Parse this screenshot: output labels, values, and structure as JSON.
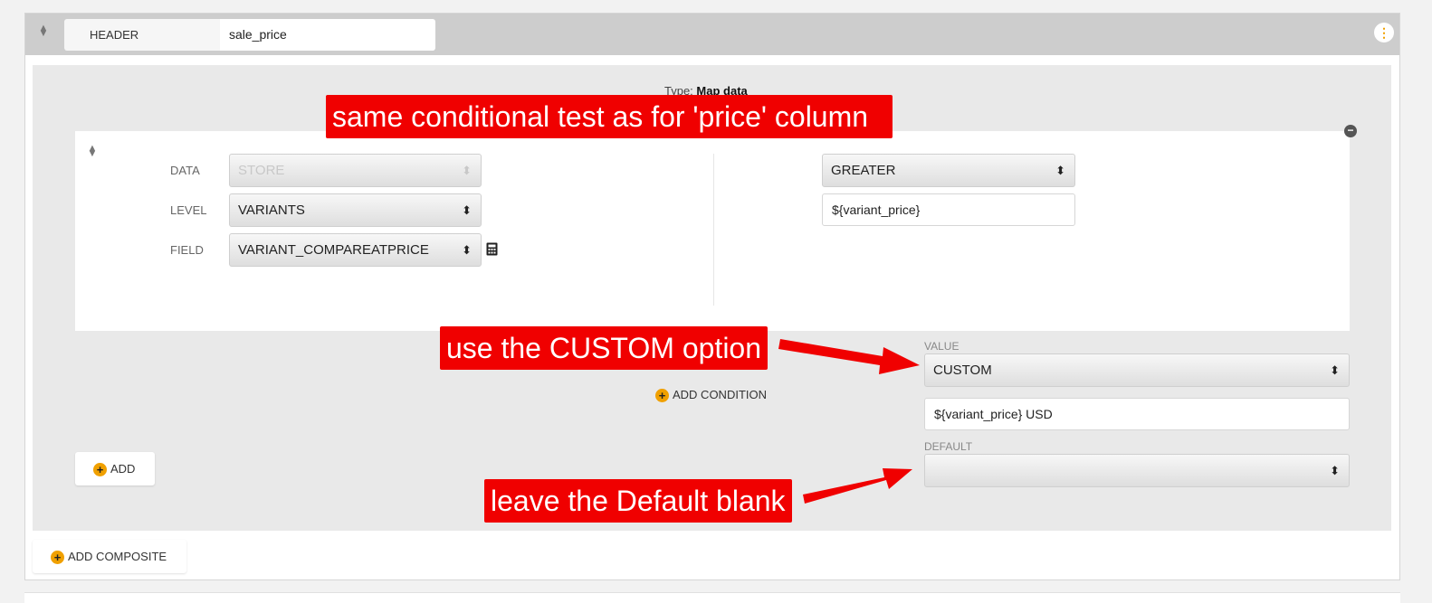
{
  "header": {
    "label": "HEADER",
    "value": "sale_price"
  },
  "type": {
    "label": "Type:",
    "value": "Map data"
  },
  "condition": {
    "left": {
      "data_label": "DATA",
      "data_value": "STORE",
      "level_label": "LEVEL",
      "level_value": "VARIANTS",
      "field_label": "FIELD",
      "field_value": "VARIANT_COMPAREATPRICE"
    },
    "right": {
      "operator": "GREATER",
      "operand": "${variant_price}"
    }
  },
  "value_section": {
    "value_label": "VALUE",
    "value_select": "CUSTOM",
    "custom_value": "${variant_price} USD",
    "default_label": "DEFAULT",
    "default_select": ""
  },
  "buttons": {
    "add_condition": "ADD CONDITION",
    "add": "ADD",
    "add_composite": "ADD COMPOSITE"
  },
  "annotations": {
    "callout1": "same conditional test as for 'price' column",
    "callout2": "use the CUSTOM option",
    "callout3": "leave the Default blank"
  },
  "icons": {
    "drag": "drag-handle-icon",
    "menu": "more-vertical-icon",
    "remove": "minus-circle-icon",
    "calculator": "calculator-icon",
    "plus": "plus-circle-icon"
  },
  "colors": {
    "accent": "#f0a000",
    "callout": "#f00000",
    "header_bar": "#cdcdcd"
  }
}
